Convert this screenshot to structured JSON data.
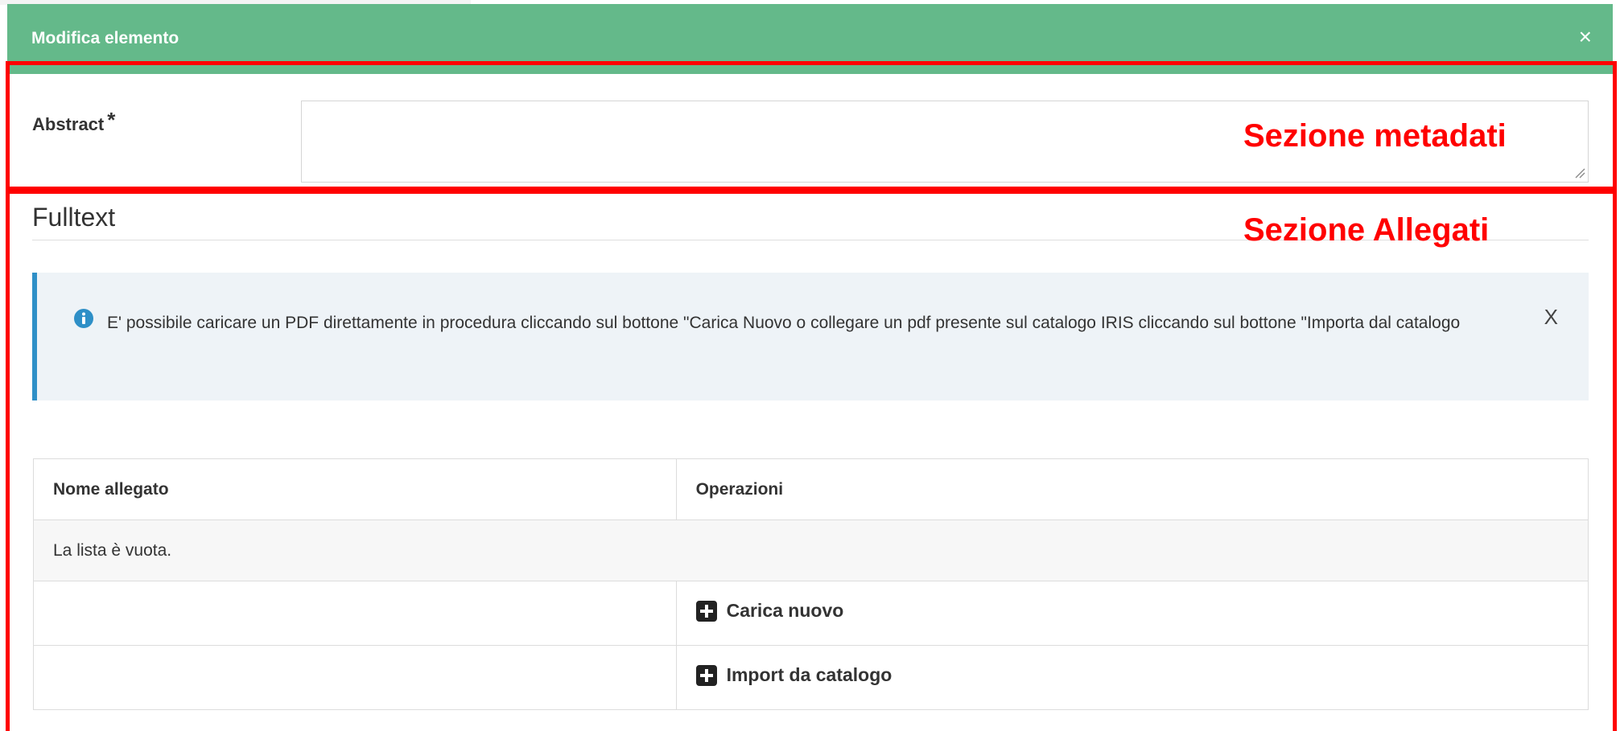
{
  "modal": {
    "title": "Modifica elemento",
    "close_label": "×"
  },
  "metadata": {
    "abstract_label": "Abstract",
    "required_mark": "*",
    "abstract_value": ""
  },
  "attachments": {
    "section_title": "Fulltext",
    "info_message": "E' possibile caricare un PDF direttamente in procedura cliccando sul bottone \"Carica Nuovo o collegare un pdf presente sul catalogo IRIS cliccando sul bottone \"Importa dal catalogo",
    "info_close_label": "X",
    "table": {
      "columns": [
        "Nome allegato",
        "Operazioni"
      ],
      "empty_message": "La lista è vuota.",
      "actions": [
        "Carica nuovo",
        "Import da catalogo"
      ]
    }
  },
  "annotations": {
    "metadata_section": "Sezione metadati",
    "attachments_section": "Sezione Allegati",
    "color": "#ff0000"
  },
  "colors": {
    "header": "#64b98a",
    "info_border": "#2e8fc7",
    "info_background": "#eef3f7"
  }
}
